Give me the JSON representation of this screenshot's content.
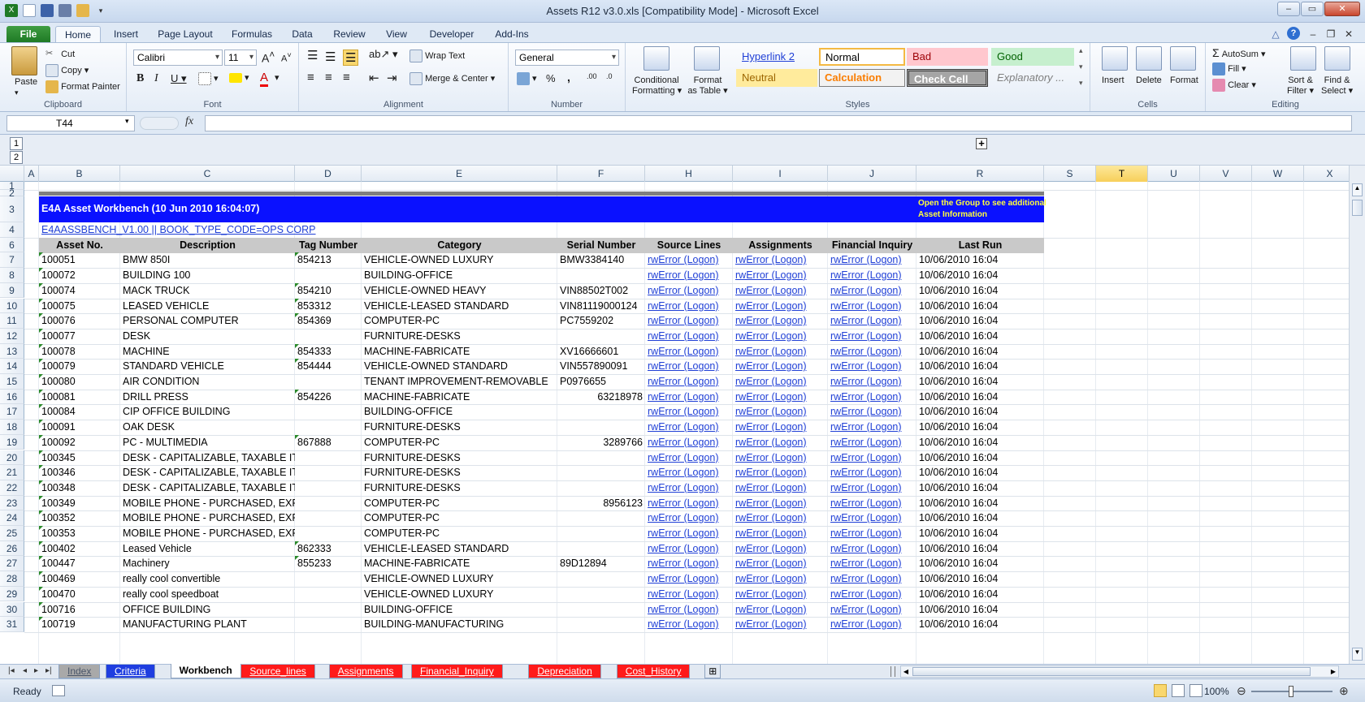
{
  "window": {
    "title": "Assets R12 v3.0.xls  [Compatibility Mode]  -  Microsoft Excel"
  },
  "ribbon_tabs": [
    "File",
    "Home",
    "Insert",
    "Page Layout",
    "Formulas",
    "Data",
    "Review",
    "View",
    "Developer",
    "Add-Ins"
  ],
  "ribbon": {
    "clipboard": {
      "paste": "Paste",
      "cut": "Cut",
      "copy": "Copy",
      "format_painter": "Format Painter",
      "label": "Clipboard"
    },
    "font": {
      "name": "Calibri",
      "size": "11",
      "label": "Font"
    },
    "alignment": {
      "wrap_text": "Wrap Text",
      "merge_center": "Merge & Center",
      "label": "Alignment"
    },
    "number": {
      "format": "General",
      "label": "Number"
    },
    "styles": {
      "conditional": "Conditional Formatting",
      "conditional_l1": "Conditional",
      "conditional_l2": "Formatting",
      "format_table_l1": "Format",
      "format_table_l2": "as Table",
      "cells": [
        {
          "name": "Hyperlink 2"
        },
        {
          "name": "Normal"
        },
        {
          "name": "Bad"
        },
        {
          "name": "Good"
        },
        {
          "name": "Neutral"
        },
        {
          "name": "Calculation"
        },
        {
          "name": "Check Cell"
        },
        {
          "name": "Explanatory ..."
        }
      ],
      "label": "Styles"
    },
    "cells": {
      "insert": "Insert",
      "delete": "Delete",
      "format": "Format",
      "label": "Cells"
    },
    "editing": {
      "autosum": "AutoSum",
      "fill": "Fill",
      "clear": "Clear",
      "sort_l1": "Sort &",
      "sort_l2": "Filter",
      "find_l1": "Find &",
      "find_l2": "Select",
      "label": "Editing"
    }
  },
  "formula_bar": {
    "name_box": "T44",
    "fx": "fx",
    "content": ""
  },
  "outline_levels": [
    "1",
    "2"
  ],
  "columns": [
    {
      "id": "A",
      "w": 18
    },
    {
      "id": "B",
      "w": 100
    },
    {
      "id": "C",
      "w": 215
    },
    {
      "id": "D",
      "w": 82
    },
    {
      "id": "E",
      "w": 241
    },
    {
      "id": "F",
      "w": 108
    },
    {
      "id": "H",
      "w": 108
    },
    {
      "id": "I",
      "w": 117
    },
    {
      "id": "J",
      "w": 109
    },
    {
      "id": "R",
      "w": 157
    },
    {
      "id": "S",
      "w": 64
    },
    {
      "id": "T",
      "w": 64
    },
    {
      "id": "U",
      "w": 64
    },
    {
      "id": "V",
      "w": 64
    },
    {
      "id": "W",
      "w": 64
    },
    {
      "id": "X",
      "w": 64
    }
  ],
  "selected_column": "T",
  "sheet": {
    "banner_title": "E4A Asset Workbench (10 Jun 2010 16:04:07)",
    "banner_note_l1": "Open the Group to see additional",
    "banner_note_l2": "Asset Information",
    "subtitle": "E4AASSBENCH_V1.00 || BOOK_TYPE_CODE=OPS CORP",
    "headers": [
      "Asset No.",
      "Description",
      "Tag Number",
      "Category",
      "Serial Number",
      "Source Lines",
      "Assignments",
      "Financial Inquiry",
      "Last Run"
    ],
    "rows": [
      {
        "r": "7",
        "asset": "100051",
        "desc": "BMW 850I",
        "tag": "854213",
        "cat": "VEHICLE-OWNED LUXURY",
        "serial": "BMW3384140",
        "serial_right": false,
        "src": "rwError (Logon)",
        "asg": "rwError (Logon)",
        "fin": "rwError (Logon)",
        "last": "10/06/2010 16:04"
      },
      {
        "r": "8",
        "asset": "100072",
        "desc": "BUILDING 100",
        "tag": "",
        "cat": "BUILDING-OFFICE",
        "serial": "",
        "serial_right": false,
        "src": "rwError (Logon)",
        "asg": "rwError (Logon)",
        "fin": "rwError (Logon)",
        "last": "10/06/2010 16:04"
      },
      {
        "r": "9",
        "asset": "100074",
        "desc": "MACK TRUCK",
        "tag": "854210",
        "cat": "VEHICLE-OWNED HEAVY",
        "serial": "VIN88502T002",
        "serial_right": false,
        "src": "rwError (Logon)",
        "asg": "rwError (Logon)",
        "fin": "rwError (Logon)",
        "last": "10/06/2010 16:04"
      },
      {
        "r": "10",
        "asset": "100075",
        "desc": "LEASED VEHICLE",
        "tag": "853312",
        "cat": "VEHICLE-LEASED STANDARD",
        "serial": "VIN81119000124",
        "serial_right": false,
        "src": "rwError (Logon)",
        "asg": "rwError (Logon)",
        "fin": "rwError (Logon)",
        "last": "10/06/2010 16:04"
      },
      {
        "r": "11",
        "asset": "100076",
        "desc": "PERSONAL COMPUTER",
        "tag": "854369",
        "cat": "COMPUTER-PC",
        "serial": "PC7559202",
        "serial_right": false,
        "src": "rwError (Logon)",
        "asg": "rwError (Logon)",
        "fin": "rwError (Logon)",
        "last": "10/06/2010 16:04"
      },
      {
        "r": "12",
        "asset": "100077",
        "desc": "DESK",
        "tag": "",
        "cat": "FURNITURE-DESKS",
        "serial": "",
        "serial_right": false,
        "src": "rwError (Logon)",
        "asg": "rwError (Logon)",
        "fin": "rwError (Logon)",
        "last": "10/06/2010 16:04"
      },
      {
        "r": "13",
        "asset": "100078",
        "desc": "MACHINE",
        "tag": "854333",
        "cat": "MACHINE-FABRICATE",
        "serial": "XV16666601",
        "serial_right": false,
        "src": "rwError (Logon)",
        "asg": "rwError (Logon)",
        "fin": "rwError (Logon)",
        "last": "10/06/2010 16:04"
      },
      {
        "r": "14",
        "asset": "100079",
        "desc": "STANDARD VEHICLE",
        "tag": "854444",
        "cat": "VEHICLE-OWNED STANDARD",
        "serial": "VIN557890091",
        "serial_right": false,
        "src": "rwError (Logon)",
        "asg": "rwError (Logon)",
        "fin": "rwError (Logon)",
        "last": "10/06/2010 16:04"
      },
      {
        "r": "15",
        "asset": "100080",
        "desc": "AIR CONDITION",
        "tag": "",
        "cat": "TENANT IMPROVEMENT-REMOVABLE",
        "serial": "P0976655",
        "serial_right": false,
        "src": "rwError (Logon)",
        "asg": "rwError (Logon)",
        "fin": "rwError (Logon)",
        "last": "10/06/2010 16:04"
      },
      {
        "r": "16",
        "asset": "100081",
        "desc": "DRILL PRESS",
        "tag": "854226",
        "cat": "MACHINE-FABRICATE",
        "serial": "63218978",
        "serial_right": true,
        "src": "rwError (Logon)",
        "asg": "rwError (Logon)",
        "fin": "rwError (Logon)",
        "last": "10/06/2010 16:04"
      },
      {
        "r": "17",
        "asset": "100084",
        "desc": "CIP OFFICE BUILDING",
        "tag": "",
        "cat": "BUILDING-OFFICE",
        "serial": "",
        "serial_right": false,
        "src": "rwError (Logon)",
        "asg": "rwError (Logon)",
        "fin": "rwError (Logon)",
        "last": "10/06/2010 16:04"
      },
      {
        "r": "18",
        "asset": "100091",
        "desc": "OAK DESK",
        "tag": "",
        "cat": "FURNITURE-DESKS",
        "serial": "",
        "serial_right": false,
        "src": "rwError (Logon)",
        "asg": "rwError (Logon)",
        "fin": "rwError (Logon)",
        "last": "10/06/2010 16:04"
      },
      {
        "r": "19",
        "asset": "100092",
        "desc": "PC - MULTIMEDIA",
        "tag": "867888",
        "cat": "COMPUTER-PC",
        "serial": "3289766",
        "serial_right": true,
        "src": "rwError (Logon)",
        "asg": "rwError (Logon)",
        "fin": "rwError (Logon)",
        "last": "10/06/2010 16:04"
      },
      {
        "r": "20",
        "asset": "100345",
        "desc": "DESK - CAPITALIZABLE, TAXABLE ITE",
        "tag": "",
        "cat": "FURNITURE-DESKS",
        "serial": "",
        "serial_right": false,
        "src": "rwError (Logon)",
        "asg": "rwError (Logon)",
        "fin": "rwError (Logon)",
        "last": "10/06/2010 16:04"
      },
      {
        "r": "21",
        "asset": "100346",
        "desc": "DESK - CAPITALIZABLE, TAXABLE ITE",
        "tag": "",
        "cat": "FURNITURE-DESKS",
        "serial": "",
        "serial_right": false,
        "src": "rwError (Logon)",
        "asg": "rwError (Logon)",
        "fin": "rwError (Logon)",
        "last": "10/06/2010 16:04"
      },
      {
        "r": "22",
        "asset": "100348",
        "desc": "DESK - CAPITALIZABLE, TAXABLE ITE",
        "tag": "",
        "cat": "FURNITURE-DESKS",
        "serial": "",
        "serial_right": false,
        "src": "rwError (Logon)",
        "asg": "rwError (Logon)",
        "fin": "rwError (Logon)",
        "last": "10/06/2010 16:04"
      },
      {
        "r": "23",
        "asset": "100349",
        "desc": "MOBILE PHONE - PURCHASED, EXPE",
        "tag": "",
        "cat": "COMPUTER-PC",
        "serial": "8956123",
        "serial_right": true,
        "src": "rwError (Logon)",
        "asg": "rwError (Logon)",
        "fin": "rwError (Logon)",
        "last": "10/06/2010 16:04"
      },
      {
        "r": "24",
        "asset": "100352",
        "desc": "MOBILE PHONE - PURCHASED, EXPE",
        "tag": "",
        "cat": "COMPUTER-PC",
        "serial": "",
        "serial_right": false,
        "src": "rwError (Logon)",
        "asg": "rwError (Logon)",
        "fin": "rwError (Logon)",
        "last": "10/06/2010 16:04"
      },
      {
        "r": "25",
        "asset": "100353",
        "desc": "MOBILE PHONE - PURCHASED, EXPE",
        "tag": "",
        "cat": "COMPUTER-PC",
        "serial": "",
        "serial_right": false,
        "src": "rwError (Logon)",
        "asg": "rwError (Logon)",
        "fin": "rwError (Logon)",
        "last": "10/06/2010 16:04"
      },
      {
        "r": "26",
        "asset": "100402",
        "desc": "Leased Vehicle",
        "tag": "862333",
        "cat": "VEHICLE-LEASED STANDARD",
        "serial": "",
        "serial_right": false,
        "src": "rwError (Logon)",
        "asg": "rwError (Logon)",
        "fin": "rwError (Logon)",
        "last": "10/06/2010 16:04"
      },
      {
        "r": "27",
        "asset": "100447",
        "desc": "Machinery",
        "tag": "855233",
        "cat": "MACHINE-FABRICATE",
        "serial": "89D12894",
        "serial_right": false,
        "src": "rwError (Logon)",
        "asg": "rwError (Logon)",
        "fin": "rwError (Logon)",
        "last": "10/06/2010 16:04"
      },
      {
        "r": "28",
        "asset": "100469",
        "desc": "really cool convertible",
        "tag": "",
        "cat": "VEHICLE-OWNED LUXURY",
        "serial": "",
        "serial_right": false,
        "src": "rwError (Logon)",
        "asg": "rwError (Logon)",
        "fin": "rwError (Logon)",
        "last": "10/06/2010 16:04"
      },
      {
        "r": "29",
        "asset": "100470",
        "desc": "really cool speedboat",
        "tag": "",
        "cat": "VEHICLE-OWNED LUXURY",
        "serial": "",
        "serial_right": false,
        "src": "rwError (Logon)",
        "asg": "rwError (Logon)",
        "fin": "rwError (Logon)",
        "last": "10/06/2010 16:04"
      },
      {
        "r": "30",
        "asset": "100716",
        "desc": "OFFICE BUILDING",
        "tag": "",
        "cat": "BUILDING-OFFICE",
        "serial": "",
        "serial_right": false,
        "src": "rwError (Logon)",
        "asg": "rwError (Logon)",
        "fin": "rwError (Logon)",
        "last": "10/06/2010 16:04"
      },
      {
        "r": "31",
        "asset": "100719",
        "desc": "MANUFACTURING PLANT",
        "tag": "",
        "cat": "BUILDING-MANUFACTURING",
        "serial": "",
        "serial_right": false,
        "src": "rwError (Logon)",
        "asg": "rwError (Logon)",
        "fin": "rwError (Logon)",
        "last": "10/06/2010 16:04"
      }
    ]
  },
  "sheet_tabs": [
    {
      "label": "Index",
      "bg": "#a9a9a9",
      "fg": "#4a5568"
    },
    {
      "label": "Criteria",
      "bg": "#1f3ee0",
      "fg": "#ffffff"
    },
    {
      "label": "Workbench",
      "bg": "#ffffff",
      "fg": "#000000",
      "active": true
    },
    {
      "label": "Source_lines",
      "bg": "#ff1a1a",
      "fg": "#ffffff"
    },
    {
      "label": "Assignments",
      "bg": "#ff1a1a",
      "fg": "#ffffff"
    },
    {
      "label": "Financial_Inquiry",
      "bg": "#ff1a1a",
      "fg": "#ffffff"
    },
    {
      "label": "Depreciation",
      "bg": "#ff1a1a",
      "fg": "#ffffff"
    },
    {
      "label": "Cost_History",
      "bg": "#ff1a1a",
      "fg": "#ffffff"
    }
  ],
  "status": {
    "ready": "Ready",
    "zoom": "100%"
  }
}
